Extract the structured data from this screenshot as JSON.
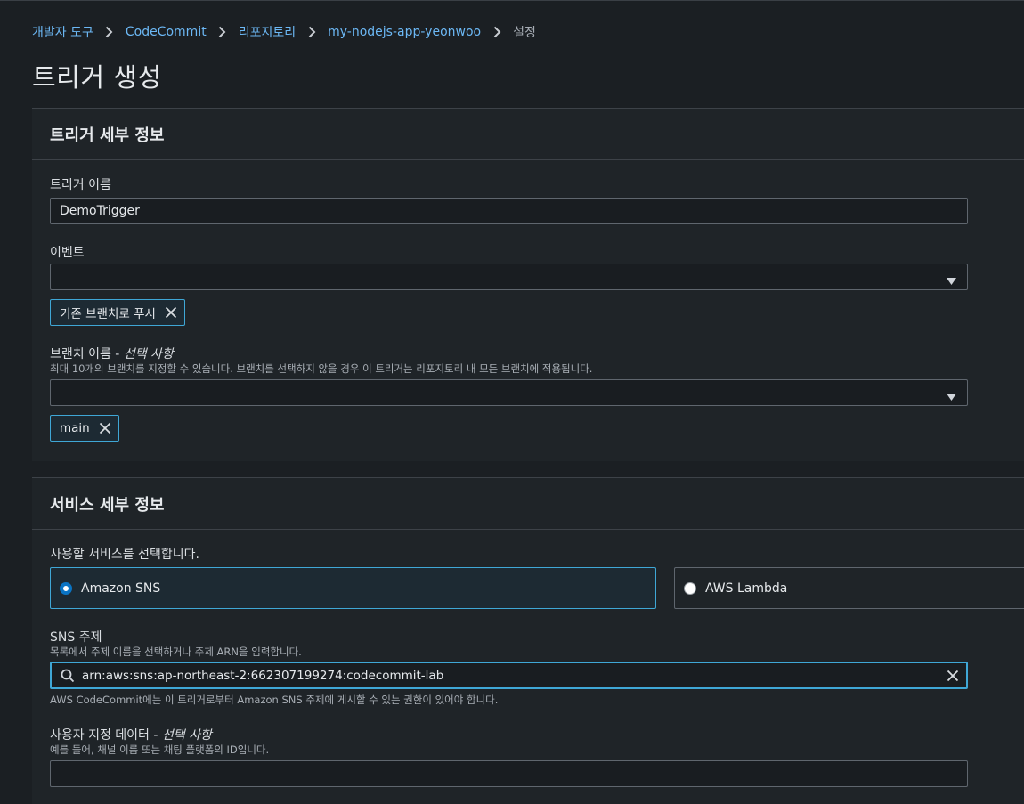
{
  "breadcrumb": {
    "items": [
      "개발자 도구",
      "CodeCommit",
      "리포지토리",
      "my-nodejs-app-yeonwoo"
    ],
    "current": "설정"
  },
  "page": {
    "title": "트리거 생성"
  },
  "trigger_details": {
    "heading": "트리거 세부 정보",
    "name_label": "트리거 이름",
    "name_value": "DemoTrigger",
    "events_label": "이벤트",
    "events_selected": "",
    "events_token": "기존 브랜치로 푸시",
    "branch_label": "브랜치 이름 -",
    "branch_optional": "선택 사항",
    "branch_desc": "최대 10개의 브랜치를 지정할 수 있습니다. 브랜치를 선택하지 않을 경우 이 트리거는 리포지토리 내 모든 브랜치에 적용됩니다.",
    "branch_selected": "",
    "branch_token": "main"
  },
  "service_details": {
    "heading": "서비스 세부 정보",
    "choose_label": "사용할 서비스를 선택합니다.",
    "options": [
      {
        "label": "Amazon SNS",
        "selected": true
      },
      {
        "label": "AWS Lambda",
        "selected": false
      }
    ],
    "sns_label": "SNS 주제",
    "sns_desc": "목록에서 주제 이름을 선택하거나 주제 ARN을 입력합니다.",
    "sns_value": "arn:aws:sns:ap-northeast-2:662307199274:codecommit-lab",
    "sns_note": "AWS CodeCommit에는 이 트리거로부터 Amazon SNS 주제에 게시할 수 있는 권한이 있어야 합니다.",
    "custom_label": "사용자 지정 데이터 -",
    "custom_optional": "선택 사항",
    "custom_desc": "예를 들어, 채널 이름 또는 채팅 플랫폼의 ID입니다.",
    "custom_value": ""
  },
  "colors": {
    "link": "#6cb8f5",
    "accent": "#3fa7d6",
    "radio_on": "#0a74c4",
    "background": "#1b1f23",
    "panel": "#1f2428"
  },
  "icons": [
    "chevron-right-icon",
    "caret-down-icon",
    "close-icon",
    "search-icon"
  ]
}
